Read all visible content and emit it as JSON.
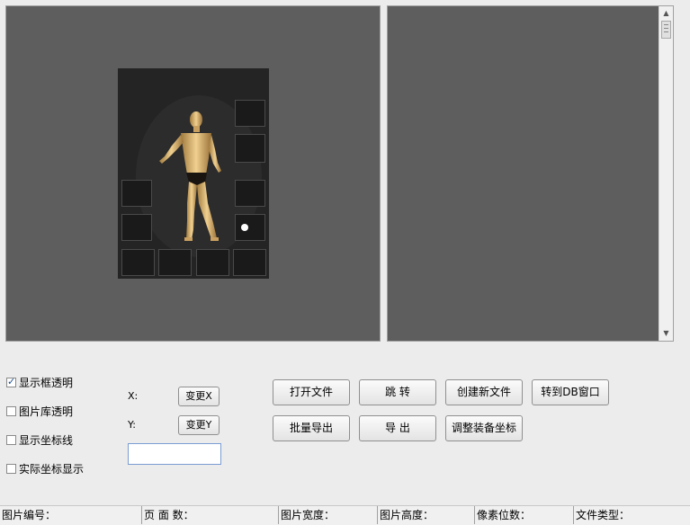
{
  "checkboxes": [
    {
      "label": "显示框透明",
      "checked": true
    },
    {
      "label": "图片库透明",
      "checked": false
    },
    {
      "label": "显示坐标线",
      "checked": false
    },
    {
      "label": "实际坐标显示",
      "checked": false
    }
  ],
  "coords": {
    "x_label": "X:",
    "y_label": "Y:",
    "change_x": "变更X",
    "change_y": "变更Y",
    "input_value": ""
  },
  "buttons": {
    "open_file": "打开文件",
    "jump": "跳 转",
    "create_new_file": "创建新文件",
    "to_db_window": "转到DB窗口",
    "batch_export": "批量导出",
    "export": "导 出",
    "adjust_equip_coords": "调整装备坐标"
  },
  "status_bar": {
    "image_number": "图片编号：",
    "page_count": "页 面 数：",
    "image_width": "图片宽度：",
    "image_height": "图片高度：",
    "pixel_bits": "像素位数：",
    "file_type": "文件类型："
  },
  "icons": {
    "scroll_up": "up-arrow",
    "scroll_down": "down-arrow"
  },
  "colors": {
    "panel_bg": "#5e5e5e",
    "window_bg": "#ececec"
  }
}
